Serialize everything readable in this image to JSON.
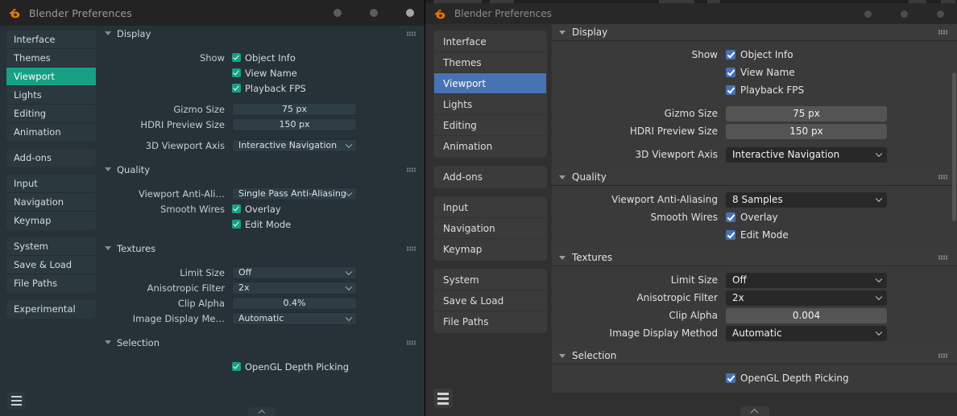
{
  "accent_colors": {
    "left_theme_accent": "#17a085",
    "right_theme_accent": "#4772b3",
    "blender_logo_orange": "#ea7600",
    "left_bg": "#263238",
    "right_bg": "#303030"
  },
  "left_window": {
    "title": "Blender Preferences",
    "icon": "blender-logo-icon",
    "window_buttons": [
      "minimize-dot",
      "maximize-dot",
      "close-dot"
    ],
    "sidebar": {
      "groups": [
        {
          "items": [
            "Interface",
            "Themes",
            "Viewport",
            "Lights",
            "Editing",
            "Animation"
          ]
        },
        {
          "items": [
            "Add-ons"
          ]
        },
        {
          "items": [
            "Input",
            "Navigation",
            "Keymap"
          ]
        },
        {
          "items": [
            "System",
            "Save & Load",
            "File Paths"
          ]
        },
        {
          "items": [
            "Experimental"
          ]
        }
      ],
      "active": "Viewport",
      "menu_button": "hamburger-menu"
    },
    "sections": [
      {
        "title": "Display",
        "rows": [
          {
            "type": "checkbox",
            "label": "Show",
            "text": "Object Info",
            "checked": true
          },
          {
            "type": "checkbox",
            "label": "",
            "text": "View Name",
            "checked": true
          },
          {
            "type": "checkbox",
            "label": "",
            "text": "Playback FPS",
            "checked": true
          },
          {
            "type": "value",
            "label": "Gizmo Size",
            "value": "75 px"
          },
          {
            "type": "value",
            "label": "HDRI Preview Size",
            "value": "150 px"
          },
          {
            "type": "select",
            "label": "3D Viewport Axis",
            "value": "Interactive Navigation"
          }
        ]
      },
      {
        "title": "Quality",
        "rows": [
          {
            "type": "select",
            "label": "Viewport Anti-Ali…",
            "value": "Single Pass Anti-Aliasing"
          },
          {
            "type": "checkbox",
            "label": "Smooth Wires",
            "text": "Overlay",
            "checked": true
          },
          {
            "type": "checkbox",
            "label": "",
            "text": "Edit Mode",
            "checked": true
          }
        ]
      },
      {
        "title": "Textures",
        "rows": [
          {
            "type": "select",
            "label": "Limit Size",
            "value": "Off"
          },
          {
            "type": "select",
            "label": "Anisotropic Filter",
            "value": "2x"
          },
          {
            "type": "value",
            "label": "Clip Alpha",
            "value": "0.4%"
          },
          {
            "type": "select",
            "label": "Image Display Me…",
            "value": "Automatic"
          }
        ]
      },
      {
        "title": "Selection",
        "rows": [
          {
            "type": "checkbox",
            "label": "",
            "text": "OpenGL Depth Picking",
            "checked": true
          }
        ]
      }
    ]
  },
  "right_window": {
    "title": "Blender Preferences",
    "icon": "blender-logo-icon",
    "window_buttons": [
      "minimize-dot",
      "maximize-dot",
      "close-dot"
    ],
    "sidebar": {
      "groups": [
        {
          "items": [
            "Interface",
            "Themes",
            "Viewport",
            "Lights",
            "Editing",
            "Animation"
          ]
        },
        {
          "items": [
            "Add-ons"
          ]
        },
        {
          "items": [
            "Input",
            "Navigation",
            "Keymap"
          ]
        },
        {
          "items": [
            "System",
            "Save & Load",
            "File Paths"
          ]
        }
      ],
      "active": "Viewport",
      "menu_button": "hamburger-menu"
    },
    "sections": [
      {
        "title": "Display",
        "rows": [
          {
            "type": "checkbox",
            "label": "Show",
            "text": "Object Info",
            "checked": true
          },
          {
            "type": "checkbox",
            "label": "",
            "text": "View Name",
            "checked": true
          },
          {
            "type": "checkbox",
            "label": "",
            "text": "Playback FPS",
            "checked": true
          },
          {
            "type": "value",
            "label": "Gizmo Size",
            "value": "75 px"
          },
          {
            "type": "value",
            "label": "HDRI Preview Size",
            "value": "150 px"
          },
          {
            "type": "select",
            "label": "3D Viewport Axis",
            "value": "Interactive Navigation"
          }
        ]
      },
      {
        "title": "Quality",
        "rows": [
          {
            "type": "select",
            "label": "Viewport Anti-Aliasing",
            "value": "8 Samples"
          },
          {
            "type": "checkbox",
            "label": "Smooth Wires",
            "text": "Overlay",
            "checked": true
          },
          {
            "type": "checkbox",
            "label": "",
            "text": "Edit Mode",
            "checked": true
          }
        ]
      },
      {
        "title": "Textures",
        "rows": [
          {
            "type": "select",
            "label": "Limit Size",
            "value": "Off"
          },
          {
            "type": "select",
            "label": "Anisotropic Filter",
            "value": "2x"
          },
          {
            "type": "value",
            "label": "Clip Alpha",
            "value": "0.004"
          },
          {
            "type": "select",
            "label": "Image Display Method",
            "value": "Automatic"
          }
        ]
      },
      {
        "title": "Selection",
        "rows": [
          {
            "type": "checkbox",
            "label": "",
            "text": "OpenGL Depth Picking",
            "checked": true
          }
        ]
      }
    ]
  }
}
